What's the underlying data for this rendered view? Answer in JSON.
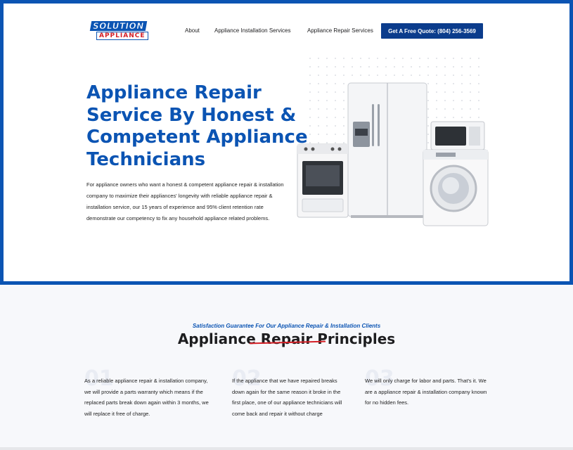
{
  "logo": {
    "line1": "SOLUTION",
    "line2": "APPLIANCE"
  },
  "nav": {
    "about": "About",
    "installation": "Appliance Installation Services",
    "repair": "Appliance Repair Services",
    "quote_button": "Get A Free Quote: (804) 256-3569"
  },
  "hero": {
    "title": "Appliance Repair Service By Honest & Competent Appliance Technicians",
    "description": "For appliance owners who want a honest & competent appliance repair & installation company to maximize their appliances' longevity with reliable appliance repair & installation service, our 15 years of experience and 95% client retention rate demonstrate our competency to fix any household appliance related problems."
  },
  "principles": {
    "subheading": "Satisfaction Guarantee For Our Appliance Repair & Installation Clients",
    "title": "Appliance Repair Principles",
    "items": [
      {
        "num": "01",
        "text": "As a reliable appliance repair & installation company, we will provide a parts warranty which means if the replaced parts break down again within 3 months, we will replace it free of charge."
      },
      {
        "num": "02",
        "text": "If the appliance that we have repaired breaks down again for the same reason it broke in the first place, one of our appliance technicians will come back and repair it without charge"
      },
      {
        "num": "03",
        "text": "We will only charge for labor and parts. That's it. We are a appliance repair & installation company known for no hidden fees."
      }
    ]
  },
  "colors": {
    "brand_blue": "#0b54b3",
    "brand_red": "#d52027",
    "button_navy": "#0b3c8c"
  }
}
